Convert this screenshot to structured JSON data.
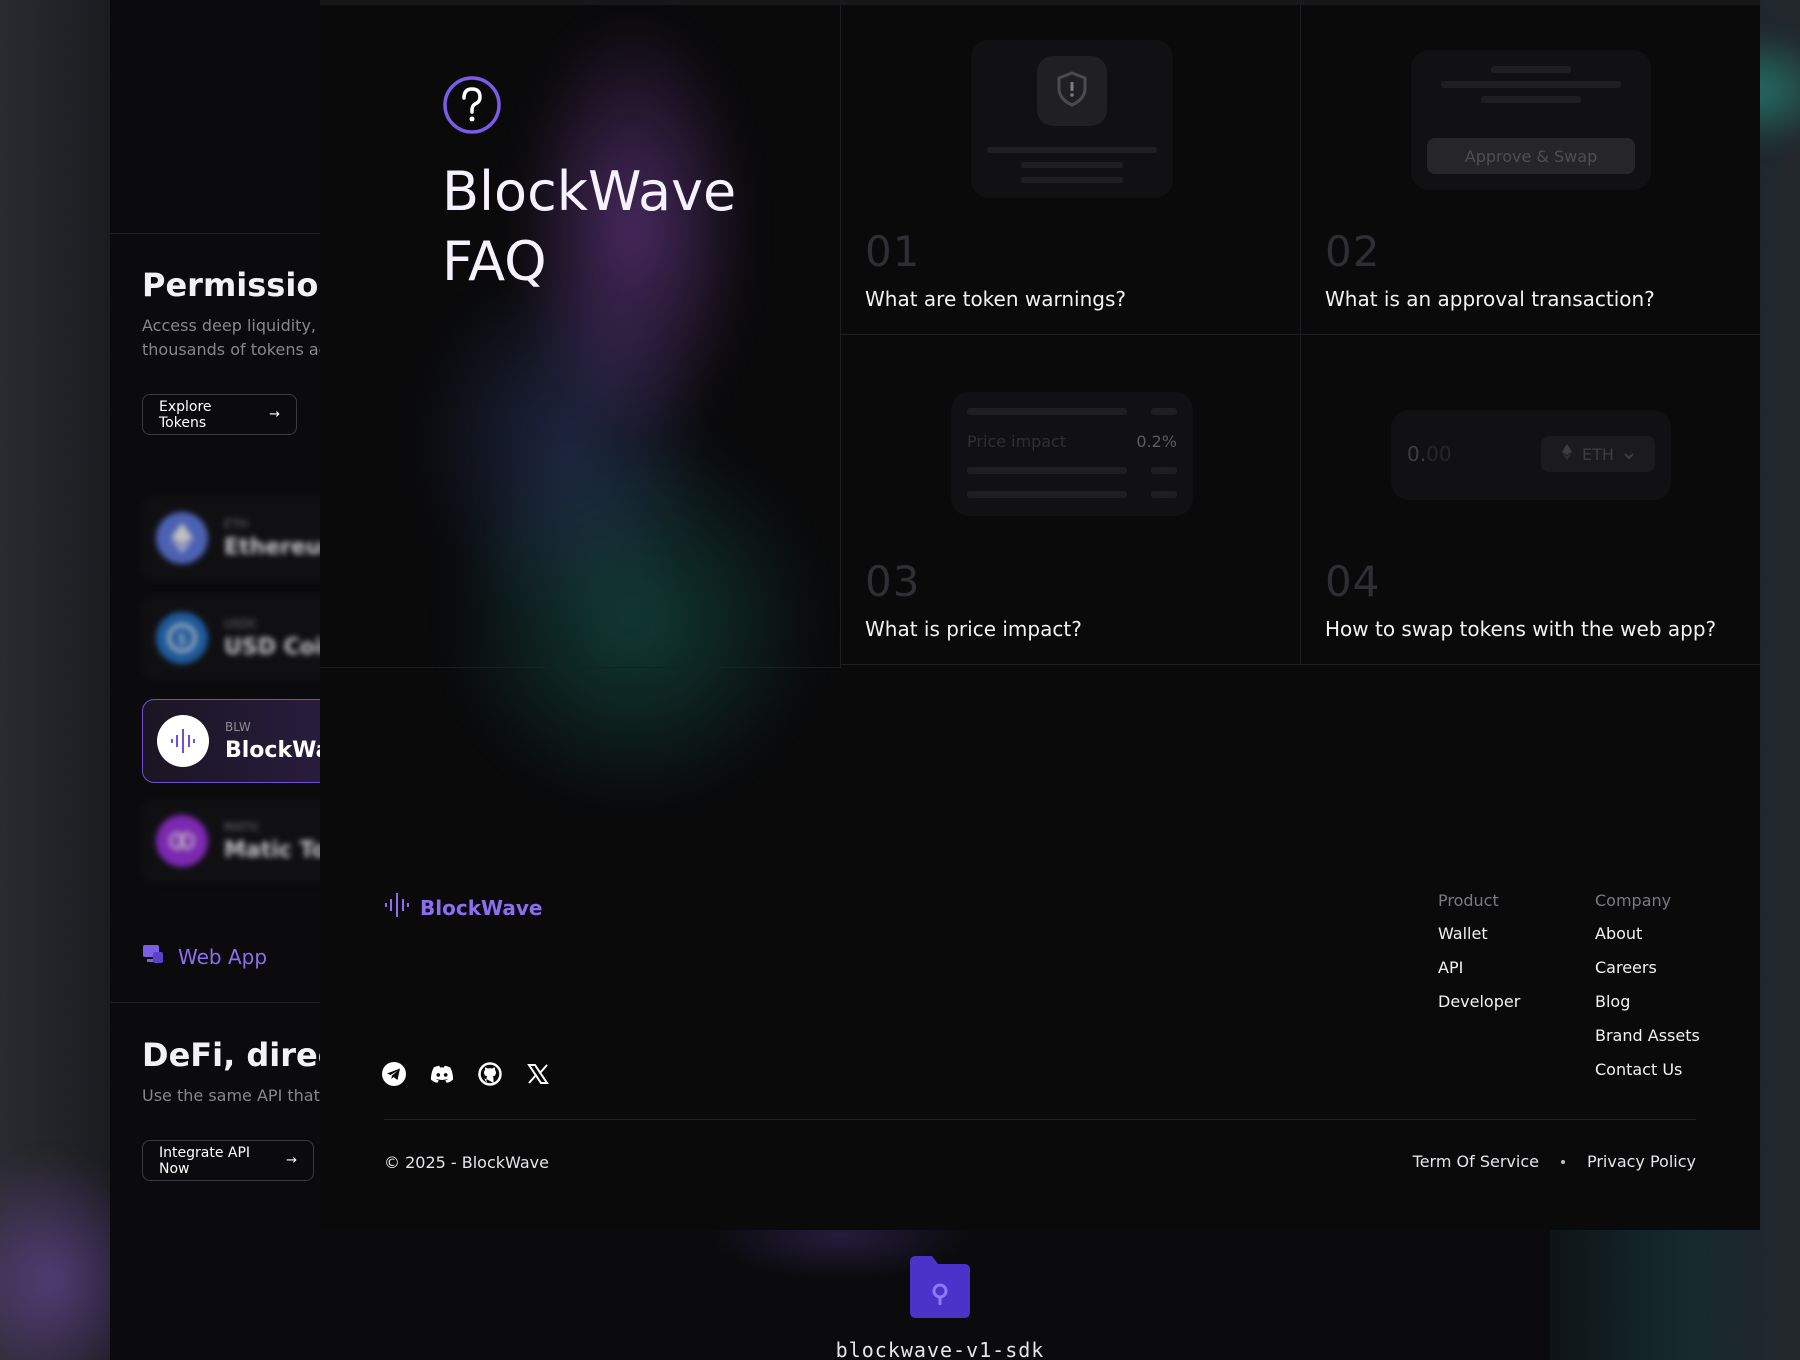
{
  "background_page": {
    "hero": {
      "title": "Permissionl",
      "description": "Access deep liquidity, e thousands of tokens ac",
      "explore_button": "Explore Tokens"
    },
    "tokens": [
      {
        "symbol": "ETH",
        "name": "Ethereum",
        "color": "#627eea"
      },
      {
        "symbol": "USDC",
        "name": "USD Coin",
        "color": "#2775ca"
      },
      {
        "symbol": "BLW",
        "name": "BlockWa",
        "color": "#ffffff"
      },
      {
        "symbol": "MATIC",
        "name": "Matic To",
        "color": "#8247e5"
      }
    ],
    "web_app_link": "Web App",
    "defi": {
      "title": "DeFi, direct",
      "description": "Use the same API that p",
      "api_button": "Integrate API Now"
    },
    "folder_label": "blockwave-v1-sdk"
  },
  "faq": {
    "title_line1": "BlockWave",
    "title_line2": "FAQ",
    "items": [
      {
        "number": "01",
        "question": "What are token warnings?"
      },
      {
        "number": "02",
        "question": "What is an approval transaction?"
      },
      {
        "number": "03",
        "question": "What is price impact?"
      },
      {
        "number": "04",
        "question": "How to swap tokens with the web app?"
      }
    ],
    "illustrations": {
      "approve_button": "Approve & Swap",
      "price_impact_label": "Price impact",
      "price_impact_value": "0.2%",
      "amount_int": "0.",
      "amount_dec": "00",
      "token_select": "ETH"
    }
  },
  "footer": {
    "brand": "BlockWave",
    "columns": [
      {
        "heading": "Product",
        "links": [
          "Wallet",
          "API",
          "Developer"
        ]
      },
      {
        "heading": "Company",
        "links": [
          "About",
          "Careers",
          "Blog",
          "Brand Assets",
          "Contact Us"
        ]
      }
    ],
    "socials": [
      "telegram-icon",
      "discord-icon",
      "github-icon",
      "x-icon"
    ],
    "copyright": "© 2025 - BlockWave",
    "legal": {
      "terms": "Term Of Service",
      "privacy": "Privacy Policy"
    }
  },
  "colors": {
    "accent": "#8c6ff0",
    "panel_bg": "#0a0a0b",
    "muted_number": "#2e2e33"
  }
}
